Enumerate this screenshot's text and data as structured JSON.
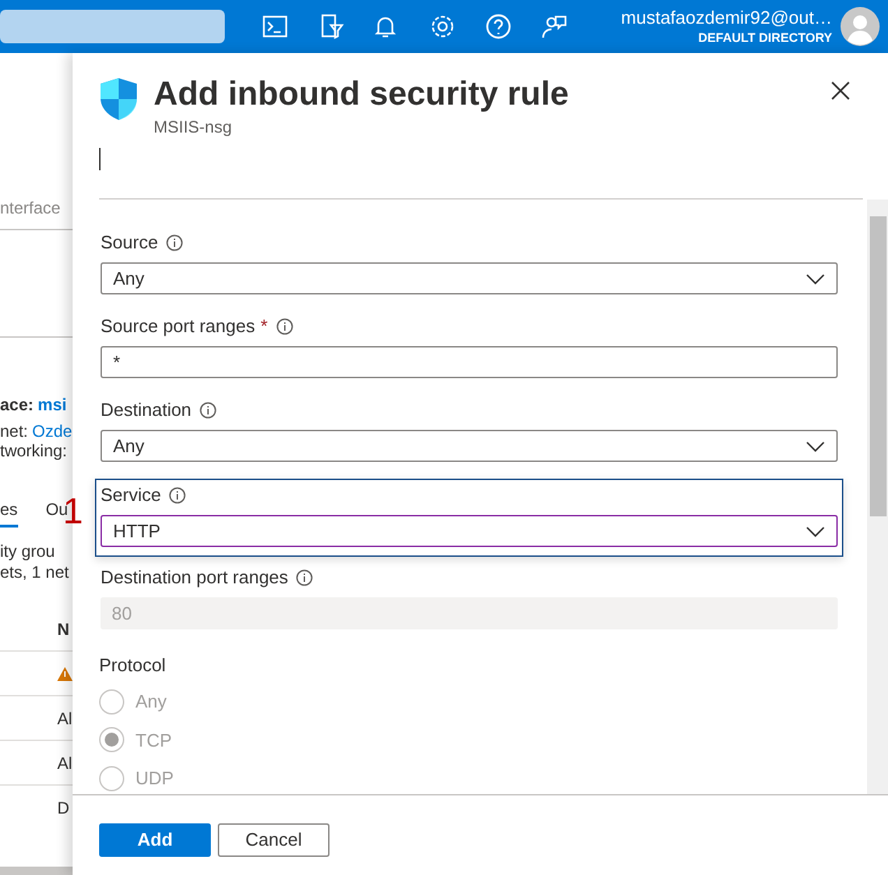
{
  "account": {
    "email": "mustafaozdemir92@out…",
    "directory": "DEFAULT DIRECTORY"
  },
  "background": {
    "tab_label": "nterface",
    "heading_label": "ace:",
    "heading_link": "msi",
    "vnet_label": "net:",
    "vnet_link": "Ozde",
    "networking_label": "tworking:",
    "tabs": [
      {
        "label": "es",
        "selected": true
      },
      {
        "label": "Ou",
        "selected": false
      }
    ],
    "summary": [
      "ity grou",
      "ets, 1 net"
    ],
    "column_header": "N",
    "rows": [
      {
        "kind": "warning",
        "text": ""
      },
      {
        "kind": "text",
        "text": "Al"
      },
      {
        "kind": "text",
        "text": "Al"
      },
      {
        "kind": "text",
        "text": "D"
      }
    ]
  },
  "panel": {
    "title": "Add inbound security rule",
    "subtitle": "MSIIS-nsg",
    "fields": [
      {
        "kind": "select",
        "label": "Source",
        "required": false,
        "value": "Any",
        "focused": false,
        "disabled": false
      },
      {
        "kind": "text",
        "label": "Source port ranges",
        "required": true,
        "value": "*",
        "focused": false,
        "disabled": false
      },
      {
        "kind": "select",
        "label": "Destination",
        "required": false,
        "value": "Any",
        "focused": false,
        "disabled": false
      },
      {
        "kind": "select",
        "label": "Service",
        "required": false,
        "value": "HTTP",
        "focused": true,
        "disabled": false
      },
      {
        "kind": "text",
        "label": "Destination port ranges",
        "required": false,
        "value": "80",
        "focused": false,
        "disabled": true
      }
    ],
    "protocol": {
      "label": "Protocol",
      "disabled": true,
      "options": [
        {
          "label": "Any",
          "selected": false
        },
        {
          "label": "TCP",
          "selected": true
        },
        {
          "label": "UDP",
          "selected": false
        }
      ]
    },
    "buttons": [
      {
        "label": "Add",
        "kind": "primary"
      },
      {
        "label": "Cancel",
        "kind": "secondary"
      }
    ]
  },
  "annotation": "1"
}
